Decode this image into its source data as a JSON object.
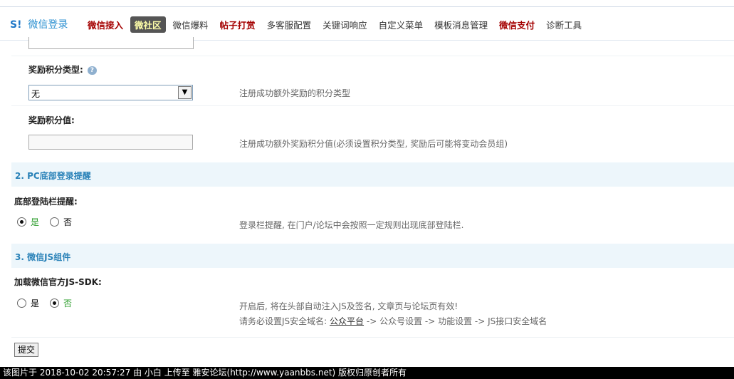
{
  "brand": {
    "logo": "S!",
    "title": "微信登录"
  },
  "nav": {
    "items": [
      {
        "label": "微信接入",
        "style": "red"
      },
      {
        "label": "微社区",
        "style": "active"
      },
      {
        "label": "微信爆料",
        "style": "normal"
      },
      {
        "label": "帖子打赏",
        "style": "red"
      },
      {
        "label": "多客服配置",
        "style": "normal"
      },
      {
        "label": "关键词响应",
        "style": "normal"
      },
      {
        "label": "自定义菜单",
        "style": "normal"
      },
      {
        "label": "模板消息管理",
        "style": "normal"
      },
      {
        "label": "微信支付",
        "style": "red"
      },
      {
        "label": "诊断工具",
        "style": "normal"
      }
    ]
  },
  "settings": {
    "reward_type": {
      "label": "奖励积分类型:",
      "selected": "无",
      "note": "注册成功额外奖励的积分类型"
    },
    "reward_value": {
      "label": "奖励积分值:",
      "value": "",
      "note": "注册成功额外奖励积分值(必须设置积分类型, 奖励后可能将变动会员组)"
    }
  },
  "section2": {
    "title": "2. PC底部登录提醒",
    "field_label": "底部登陆栏提醒:",
    "options": {
      "yes": "是",
      "no": "否"
    },
    "selected": "yes",
    "note": "登录栏提醒, 在门户/论坛中会按照一定规则出现底部登陆栏."
  },
  "section3": {
    "title": "3. 微信JS组件",
    "field_label": "加载微信官方JS-SDK:",
    "options": {
      "yes": "是",
      "no": "否"
    },
    "selected": "no",
    "note1": "开启后, 将在头部自动注入JS及签名, 文章页与论坛页有效!",
    "note2_prefix": "请务必设置JS安全域名:",
    "note2_link": "公众平台",
    "note2_suffix": " -> 公众号设置 -> 功能设置 -> JS接口安全域名"
  },
  "submit_label": "提交",
  "footer": "该图片于 2018-10-02 20:57:27 由 小白 上传至 雅安论坛(http://www.yaanbbs.net) 版权归原创者所有",
  "colors": {
    "accent": "#2a82b8",
    "red_nav": "#a40000",
    "active_nav_bg": "#555555",
    "section_bg": "#edf6fb"
  }
}
